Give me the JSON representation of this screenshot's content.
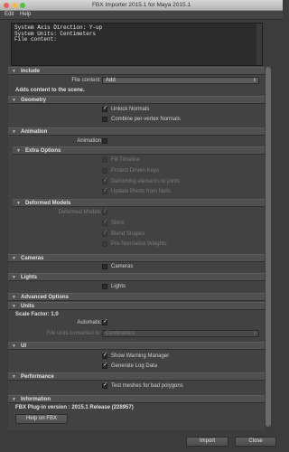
{
  "window": {
    "title": "FBX Importer 2015.1 for Maya 2015.1",
    "traffic_colors": [
      "#ec5f56",
      "#f2bd3e",
      "#52c340"
    ]
  },
  "menu": [
    "Edit",
    "Help"
  ],
  "log": [
    "System Axis Direction: Y-up",
    "System Units: Centimeters",
    "File content:"
  ],
  "include": {
    "title": "Include",
    "file_content_label": "File content:",
    "file_content_value": "Add",
    "adds_content_text": "Adds content to the scene."
  },
  "geometry": {
    "title": "Geometry",
    "unlock_normals": {
      "label": "Unlock Normals",
      "checked": true
    },
    "combine_normals": {
      "label": "Combine per-vertex Normals",
      "checked": false
    }
  },
  "animation": {
    "title": "Animation",
    "animation_label": "Animation",
    "animation_checked": false,
    "extra_options": {
      "title": "Extra Options",
      "fill_timeline": {
        "label": "Fill Timeline",
        "checked": false
      },
      "protect_driven_keys": {
        "label": "Protect Driven Keys",
        "checked": false
      },
      "deforming_elements": {
        "label": "Deforming elements to joints",
        "checked": true
      },
      "update_pivots": {
        "label": "Update Pivots from Nulls",
        "checked": true
      }
    },
    "deformed_models": {
      "title": "Deformed Models",
      "deformed_models_label": "Deformed Models",
      "deformed_models_checked": true,
      "skins": {
        "label": "Skins",
        "checked": true
      },
      "blend_shapes": {
        "label": "Blend Shapes",
        "checked": true
      },
      "prenormalize": {
        "label": "Pre-Normalize Weights",
        "checked": false
      }
    }
  },
  "cameras": {
    "title": "Cameras",
    "label": "Cameras",
    "checked": false
  },
  "lights": {
    "title": "Lights",
    "label": "Lights",
    "checked": false
  },
  "advanced": {
    "title": "Advanced Options",
    "units": {
      "title": "Units",
      "scale_factor": "Scale Factor: 1.0",
      "automatic_label": "Automatic",
      "automatic_checked": true,
      "converted_label": "File units converted to:",
      "converted_value": "Centimeters"
    },
    "ui": {
      "title": "UI",
      "show_warning": {
        "label": "Show Warning Manager",
        "checked": true
      },
      "generate_log": {
        "label": "Generate Log Data",
        "checked": true
      }
    },
    "performance": {
      "title": "Performance",
      "test_meshes": {
        "label": "Test meshes for bad polygons",
        "checked": true
      }
    }
  },
  "information": {
    "title": "Information",
    "version_text": "FBX Plug-in version : 2015.1 Release (228957)",
    "help_button": "Help on FBX"
  },
  "footer": {
    "import_button": "Import",
    "close_button": "Close"
  },
  "glyphs": {
    "check": "✓",
    "expanded": "▼",
    "collapsed": "▶",
    "dropdown": "⇕"
  }
}
